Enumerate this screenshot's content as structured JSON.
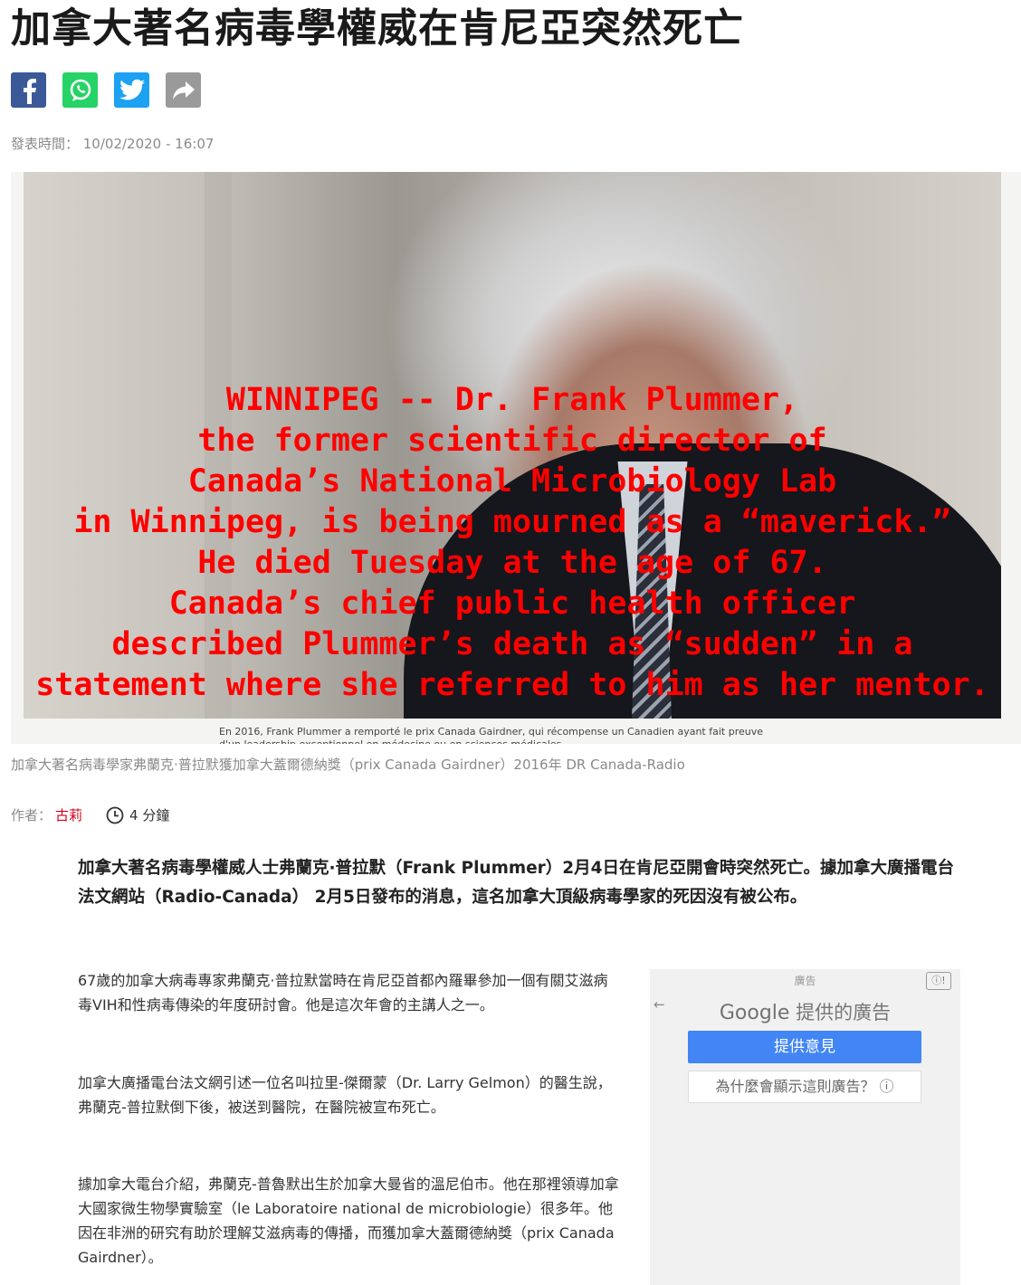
{
  "article": {
    "title": "加拿大著名病毒學權威在肯尼亞突然死亡",
    "published": "發表時間： 10/02/2020 - 16:07",
    "photo_overlay_lines": [
      "WINNIPEG -- Dr. Frank Plummer,",
      "the former scientific director of",
      "Canada’s National Microbiology Lab",
      "in Winnipeg, is being mourned as a “maverick.”",
      "He died Tuesday at the age of 67.",
      "Canada’s chief public health officer",
      "described Plummer’s death as “sudden” in a",
      "statement where she referred to him as her mentor."
    ],
    "photo_inner_caption": "En 2016, Frank Plummer a remporté le prix Canada Gairdner, qui récompense un Canadien ayant fait preuve",
    "photo_inner_caption_2": "d'un leadership exceptionnel en médecine ou en sciences médicales.",
    "photo_caption": "加拿大著名病毒學家弗蘭克·普拉默獲加拿大蓋爾德納獎（prix Canada Gairdner）2016年 DR Canada-Radio",
    "author_label": "作者：",
    "author_name": "古莉",
    "read_time": "4 分鐘",
    "lead": "加拿大著名病毒學權威人士弗蘭克·普拉默（Frank Plummer）2月4日在肯尼亞開會時突然死亡。據加拿大廣播電台法文網站（Radio-Canada） 2月5日發布的消息，這名加拿大頂級病毒學家的死因沒有被公布。",
    "paragraphs": [
      "67歲的加拿大病毒專家弗蘭克·普拉默當時在肯尼亞首都內羅畢參加一個有關艾滋病毒VIH和性病毒傳染的年度研討會。他是這次年會的主講人之一。",
      "加拿大廣播電台法文網引述一位名叫拉里-傑爾蒙（Dr. Larry Gelmon）的醫生說，弗蘭克-普拉默倒下後，被送到醫院，在醫院被宣布死亡。",
      "據加拿大電台介紹，弗蘭克-普魯默出生於加拿大曼省的溫尼伯市。他在那裡領導加拿大國家微生物學實驗室（le Laboratoire national de microbiologie）很多年。他因在非洲的研究有助於理解艾滋病毒的傳播，而獲加拿大蓋爾德納獎（prix Canada Gairdner）。"
    ]
  },
  "share": {
    "icons": [
      "facebook-icon",
      "whatsapp-icon",
      "twitter-icon",
      "share-icon"
    ]
  },
  "ad": {
    "label": "廣告",
    "info_symbol": "ⓘ!",
    "back_symbol": "←",
    "google_word": "Google",
    "provided": " 提供的廣告",
    "feedback_button": "提供意見",
    "why_button": "為什麼會顯示這則廣告？ ⓘ"
  },
  "colors": {
    "overlay_text": "#ff0000",
    "author": "#d0021b",
    "facebook": "#3b5998",
    "whatsapp": "#25d366",
    "twitter": "#1da1f2",
    "ad_button": "#4285f4"
  }
}
